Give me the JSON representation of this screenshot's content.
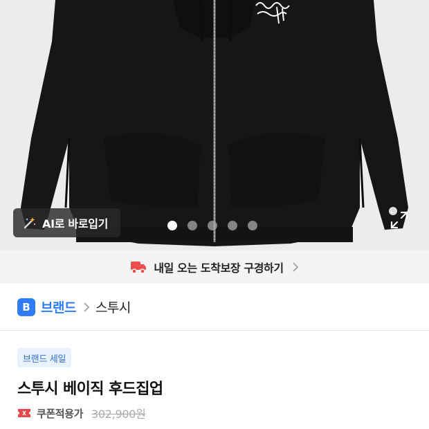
{
  "hero": {
    "ai_try_on_label": "AI로 바로입기",
    "slide_count": 5,
    "active_slide": 1,
    "hoodie_print": "Stüssy"
  },
  "delivery": {
    "text": "내일 오는 도착보장 구경하기"
  },
  "breadcrumb": {
    "badge": "B",
    "brand_link": "브랜드",
    "brand_name": "스투시"
  },
  "product": {
    "sale_badge": "브랜드 세일",
    "title": "스투시 베이직 후드집업",
    "coupon_label": "쿠폰적용가",
    "original_price": "302,900원"
  },
  "colors": {
    "accent": "#2f7cf6",
    "coupon_red": "#e8474b"
  }
}
